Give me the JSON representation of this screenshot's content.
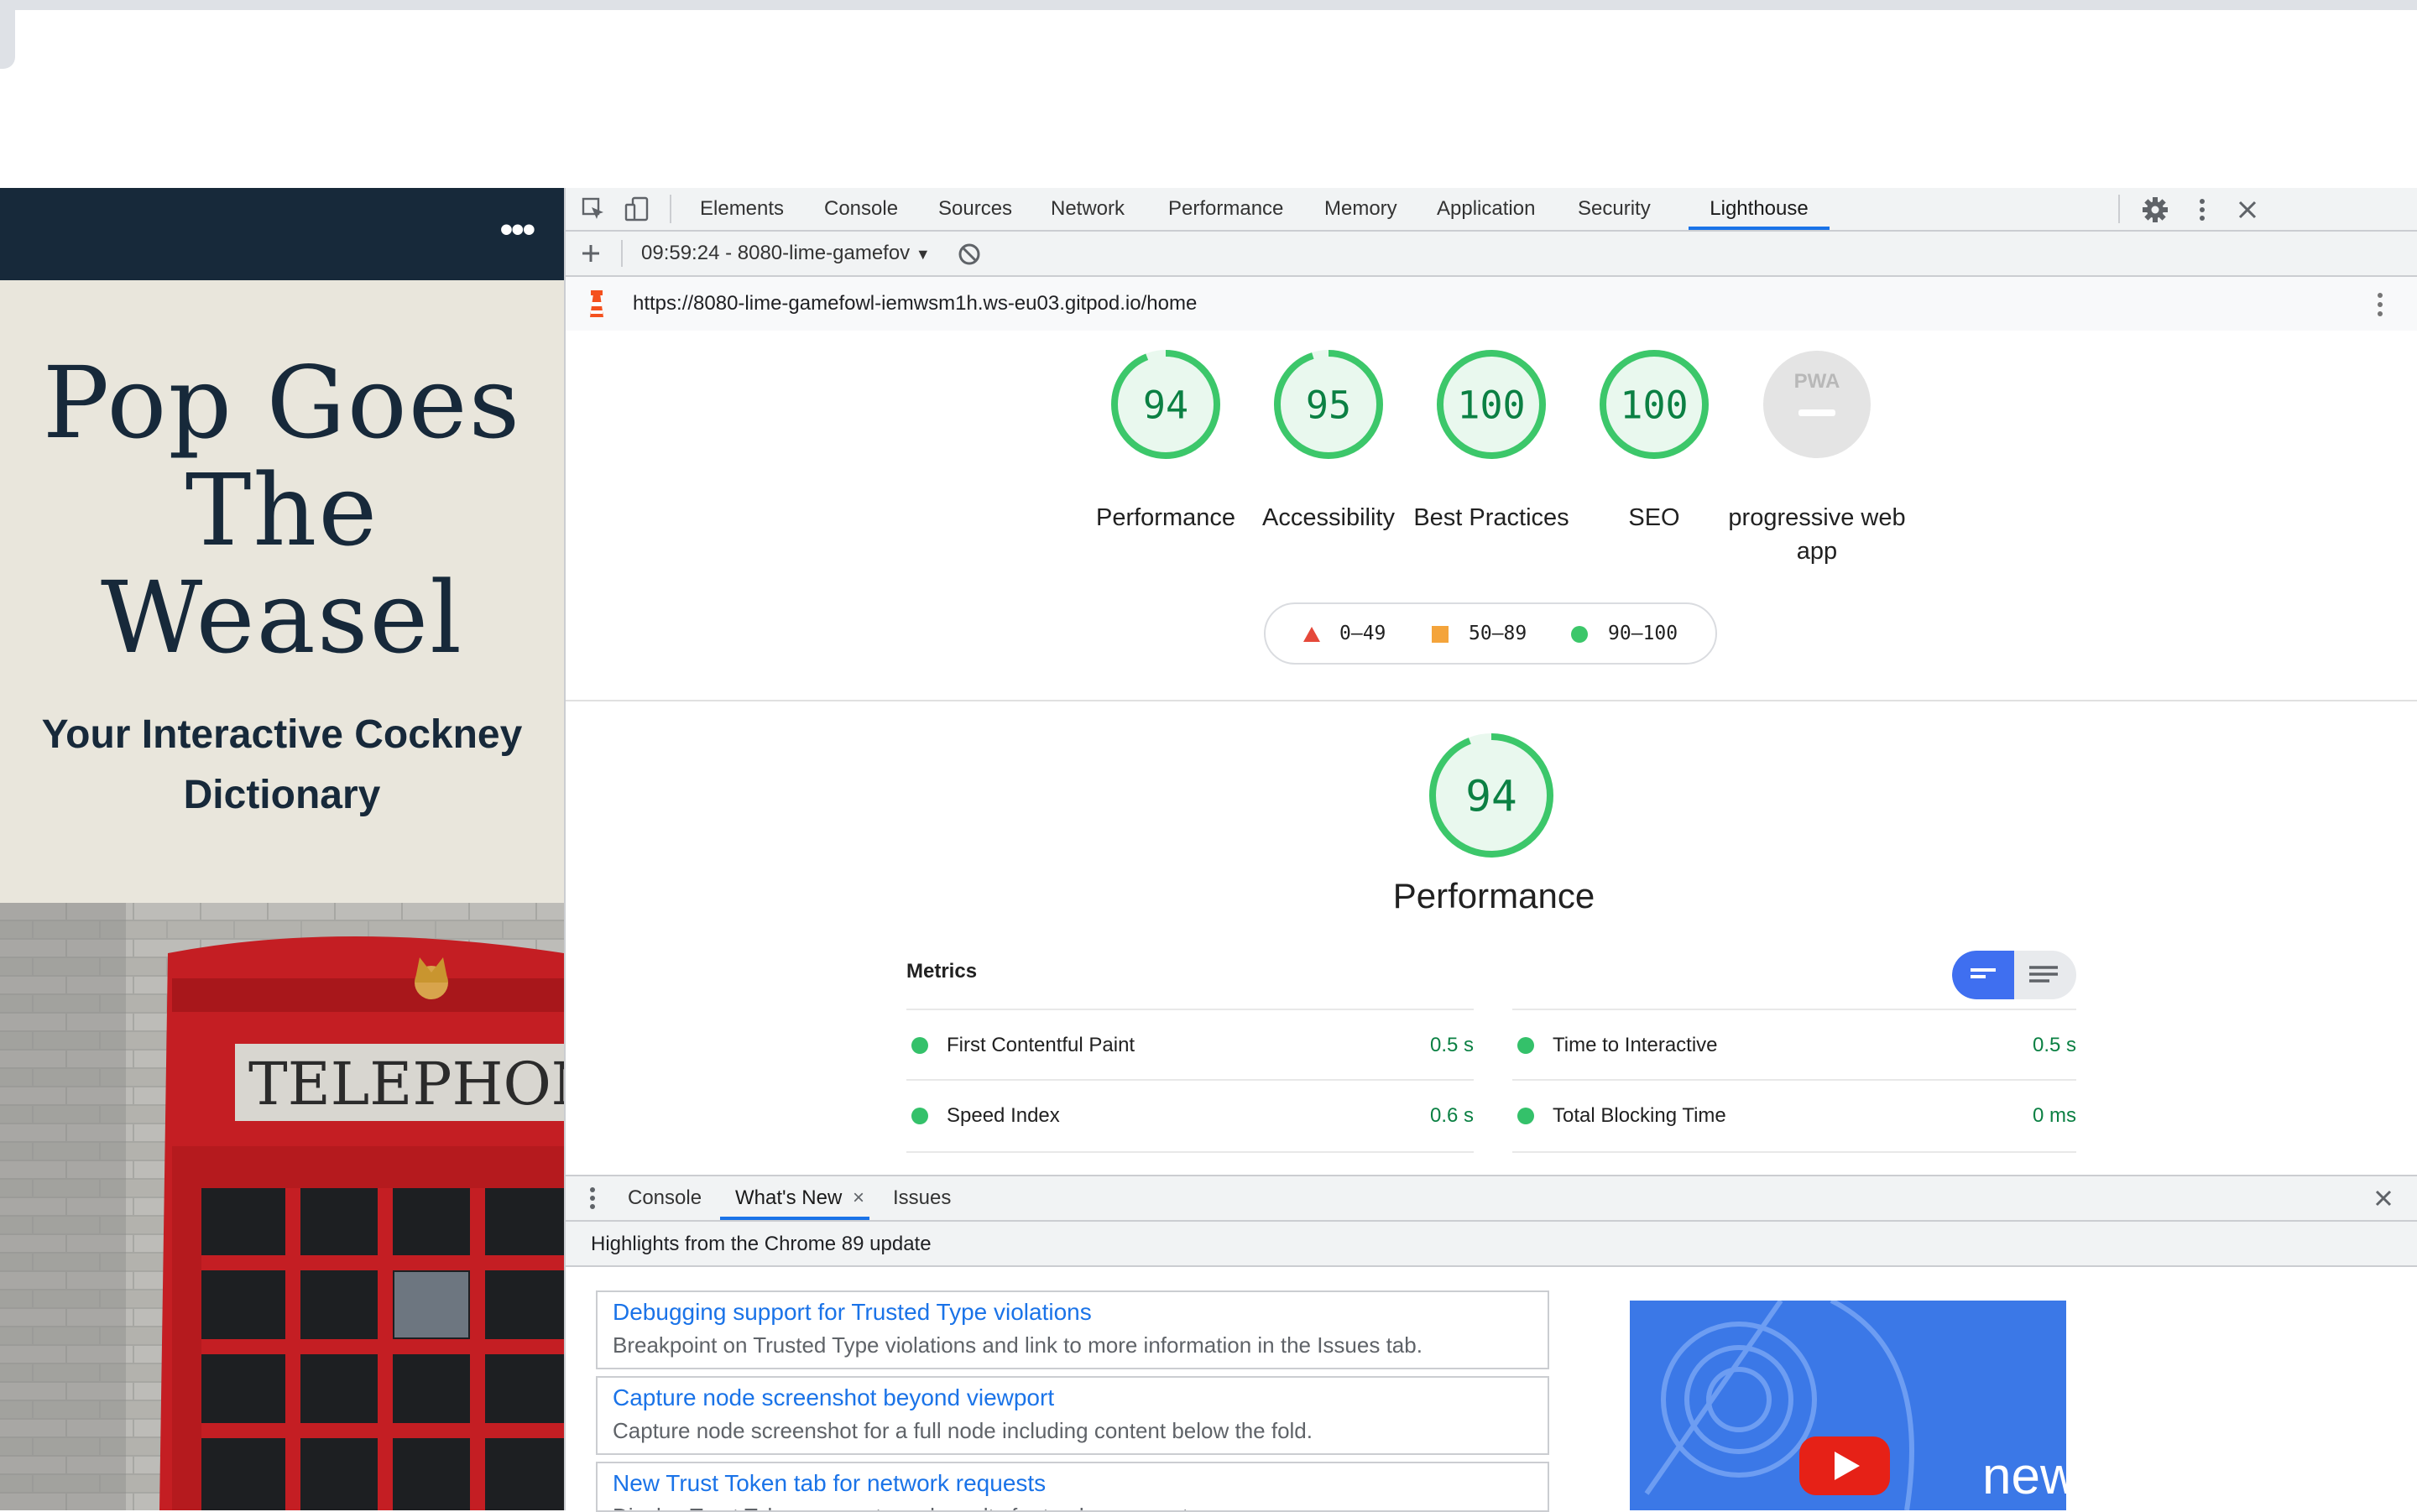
{
  "page": {
    "title_lines": [
      "Pop Goes",
      "The",
      "Weasel"
    ],
    "subtitle_lines": [
      "Your Interactive Cockney",
      "Dictionary"
    ],
    "nav_menu_label": "•••",
    "photo_sign": "TELEPHON"
  },
  "devtools": {
    "tabs": [
      "Elements",
      "Console",
      "Sources",
      "Network",
      "Performance",
      "Memory",
      "Application",
      "Security",
      "Lighthouse"
    ],
    "active_tab": "Lighthouse",
    "report_selector": "09:59:24 - 8080-lime-gamefov",
    "report_url": "https://8080-lime-gamefowl-iemwsm1h.ws-eu03.gitpod.io/home"
  },
  "lighthouse": {
    "scores": [
      {
        "label": "Performance",
        "value": "94",
        "fraction": 0.94
      },
      {
        "label": "Accessibility",
        "value": "95",
        "fraction": 0.95
      },
      {
        "label": "Best Practices",
        "value": "100",
        "fraction": 1.0
      },
      {
        "label": "SEO",
        "value": "100",
        "fraction": 1.0
      },
      {
        "label": "progressive web app",
        "value": "PWA",
        "fraction": 0
      }
    ],
    "legend": [
      {
        "shape": "triangle",
        "range": "0–49",
        "color": "#e5483a"
      },
      {
        "shape": "square",
        "range": "50–89",
        "color": "#f4a43b"
      },
      {
        "shape": "circle",
        "range": "90–100",
        "color": "#3cc76a"
      }
    ],
    "performance_section": {
      "score": "94",
      "fraction": 0.94,
      "title": "Performance",
      "metrics_heading": "Metrics",
      "metrics": [
        {
          "name": "First Contentful Paint",
          "value": "0.5 s"
        },
        {
          "name": "Time to Interactive",
          "value": "0.5 s"
        },
        {
          "name": "Speed Index",
          "value": "0.6 s"
        },
        {
          "name": "Total Blocking Time",
          "value": "0 ms"
        }
      ]
    },
    "colors": {
      "pass": "#3cc76a",
      "pass_text": "#0b8043",
      "pass_fill": "#e9f8ee",
      "accent": "#1a73e8"
    }
  },
  "drawer": {
    "tabs": [
      "Console",
      "What's New",
      "Issues"
    ],
    "active_tab": "What's New",
    "highlight": "Highlights from the Chrome 89 update",
    "items": [
      {
        "title": "Debugging support for Trusted Type violations",
        "desc": "Breakpoint on Trusted Type violations and link to more information in the Issues tab."
      },
      {
        "title": "Capture node screenshot beyond viewport",
        "desc": "Capture node screenshot for a full node including content below the fold."
      },
      {
        "title": "New Trust Token tab for network requests",
        "desc": "Display Trust Token requests and results for tracker requests."
      }
    ],
    "video_label": "new"
  }
}
